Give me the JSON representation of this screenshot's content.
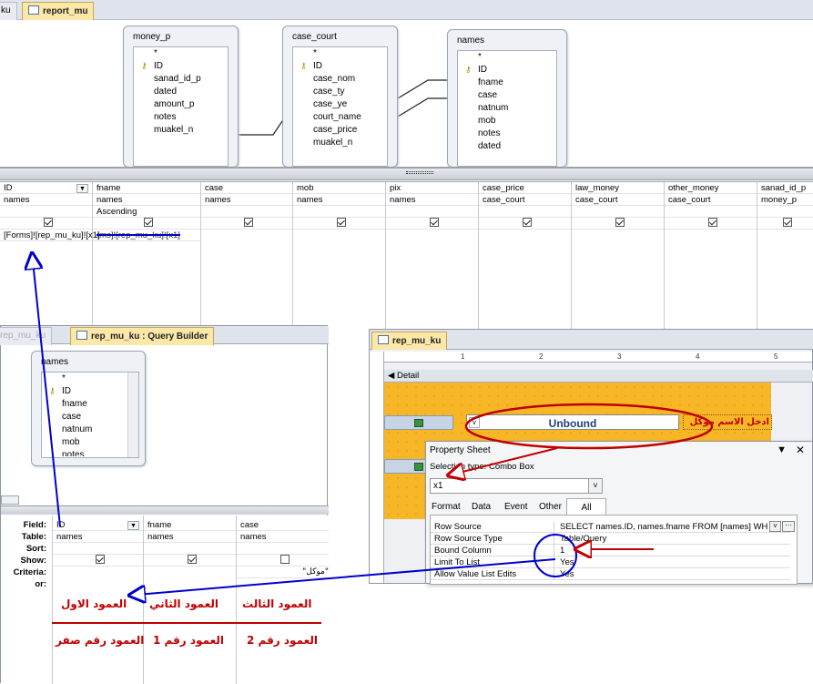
{
  "tabs": {
    "prev": "ku",
    "active": "report_mu"
  },
  "tables": [
    {
      "title": "money_p",
      "fields": [
        "*",
        "ID",
        "sanad_id_p",
        "dated",
        "amount_p",
        "notes",
        "muakel_n"
      ]
    },
    {
      "title": "case_court",
      "fields": [
        "*",
        "ID",
        "case_nom",
        "case_ty",
        "case_ye",
        "court_name",
        "case_price",
        "muakel_n"
      ]
    },
    {
      "title": "names",
      "fields": [
        "*",
        "ID",
        "fname",
        "case",
        "natnum",
        "mob",
        "notes",
        "dated"
      ]
    }
  ],
  "grid": {
    "columns": [
      {
        "field": "ID",
        "table": "names",
        "sort": "",
        "criteria": "[Forms]![rep_mu_ku]![x1]",
        "strike": "rms]![rep_mu_ku]![x1]"
      },
      {
        "field": "fname",
        "table": "names",
        "sort": "Ascending",
        "criteria": "",
        "strike": ""
      },
      {
        "field": "case",
        "table": "names",
        "sort": "",
        "criteria": "",
        "strike": ""
      },
      {
        "field": "mob",
        "table": "names",
        "sort": "",
        "criteria": "",
        "strike": ""
      },
      {
        "field": "pix",
        "table": "names",
        "sort": "",
        "criteria": "",
        "strike": ""
      },
      {
        "field": "case_price",
        "table": "case_court",
        "sort": "",
        "criteria": "",
        "strike": ""
      },
      {
        "field": "law_money",
        "table": "case_court",
        "sort": "",
        "criteria": "",
        "strike": ""
      },
      {
        "field": "other_money",
        "table": "case_court",
        "sort": "",
        "criteria": "",
        "strike": ""
      },
      {
        "field": "sanad_id_p",
        "table": "money_p",
        "sort": "",
        "criteria": "",
        "strike": ""
      }
    ]
  },
  "qb": {
    "tab_faded": "rep_mu_ku",
    "tab_title": "rep_mu_ku : Query Builder",
    "table": {
      "title": "names",
      "fields": [
        "*",
        "ID",
        "fname",
        "case",
        "natnum",
        "mob",
        "notes"
      ]
    },
    "labels": {
      "field": "Field:",
      "table": "Table:",
      "sort": "Sort:",
      "show": "Show:",
      "criteria": "Criteria:",
      "or": "or:"
    },
    "cols": [
      {
        "field": "ID",
        "table": "names",
        "show": true,
        "criteria": ""
      },
      {
        "field": "fname",
        "table": "names",
        "show": true,
        "criteria": ""
      },
      {
        "field": "case",
        "table": "names",
        "show": false,
        "criteria": "\"موكل\""
      }
    ],
    "col_names": [
      "العمود الاول",
      "العمود الثاني",
      "العمود الثالث"
    ],
    "col_numbers": [
      "العمود رقم صفر",
      "العمود رقم 1",
      "العمود رقم 2"
    ]
  },
  "report": {
    "tab": "rep_mu_ku",
    "section": "Detail",
    "unbound": "Unbound",
    "label_ar": "ادخل الاسم موكل",
    "ruler_marks": [
      "1",
      "2",
      "3",
      "4",
      "5"
    ]
  },
  "property_sheet": {
    "title": "Property Sheet",
    "selection_label": "Selection type:",
    "selection_type": "Combo Box",
    "control": "x1",
    "tabs": [
      "Format",
      "Data",
      "Event",
      "Other",
      "All"
    ],
    "rows": [
      {
        "k": "Row Source",
        "v": "SELECT names.ID, names.fname FROM [names] WH"
      },
      {
        "k": "Row Source Type",
        "v": "Table/Query"
      },
      {
        "k": "Bound Column",
        "v": "1"
      },
      {
        "k": "Limit To List",
        "v": "Yes"
      },
      {
        "k": "Allow Value List Edits",
        "v": "Yes"
      }
    ]
  },
  "colors": {
    "accent_tab": "#fbe8a8",
    "form_bg": "#f6b626",
    "annotation_red": "#c00000",
    "annotation_blue": "#0000cc"
  }
}
